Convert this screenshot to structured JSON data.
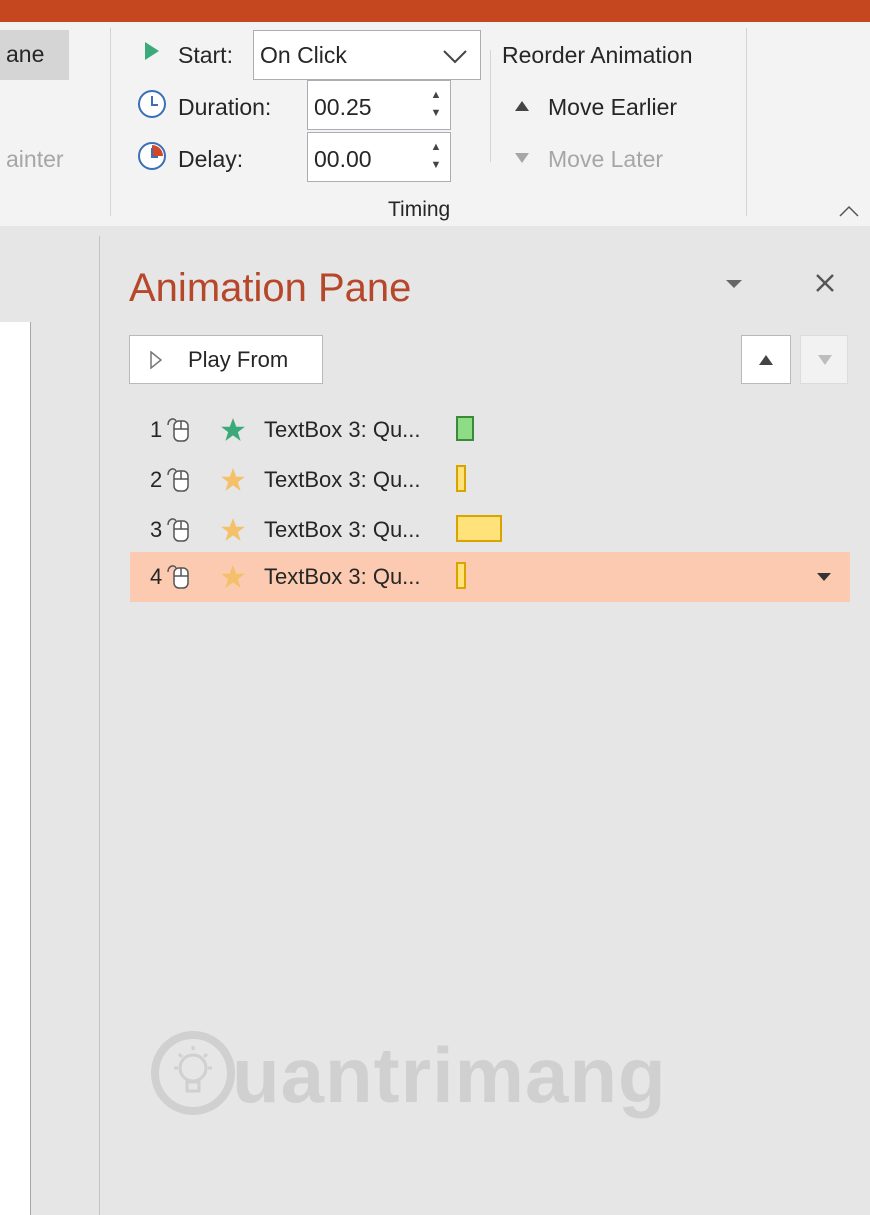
{
  "ribbon": {
    "pane_button_partial": "ane",
    "painter_partial": "ainter",
    "start_label": "Start:",
    "start_value": "On Click",
    "duration_label": "Duration:",
    "duration_value": "00.25",
    "delay_label": "Delay:",
    "delay_value": "00.00",
    "reorder_title": "Reorder Animation",
    "move_earlier": "Move Earlier",
    "move_later": "Move Later",
    "timing_group": "Timing"
  },
  "pane": {
    "title": "Animation Pane",
    "play_from": "Play From",
    "items": [
      {
        "num": "1",
        "label": "TextBox 3: Qu...",
        "star_color": "#3aaa7a",
        "bar_color": "#8fdc86",
        "bar_border": "#3b8a3b"
      },
      {
        "num": "2",
        "label": "TextBox 3: Qu...",
        "star_color": "#f4c06a",
        "bar_color": "#ffe27a",
        "bar_border": "#d9a400"
      },
      {
        "num": "3",
        "label": "TextBox 3: Qu...",
        "star_color": "#f4c06a",
        "bar_color": "#ffe27a",
        "bar_border": "#d9a400"
      },
      {
        "num": "4",
        "label": "TextBox 3: Qu...",
        "star_color": "#f4c06a",
        "bar_color": "#ffe27a",
        "bar_border": "#d9a400"
      }
    ]
  },
  "watermark": "uantrimang",
  "colors": {
    "accent": "#c4471f",
    "title_red": "#b7472a",
    "selected_row": "#fbcab0"
  }
}
